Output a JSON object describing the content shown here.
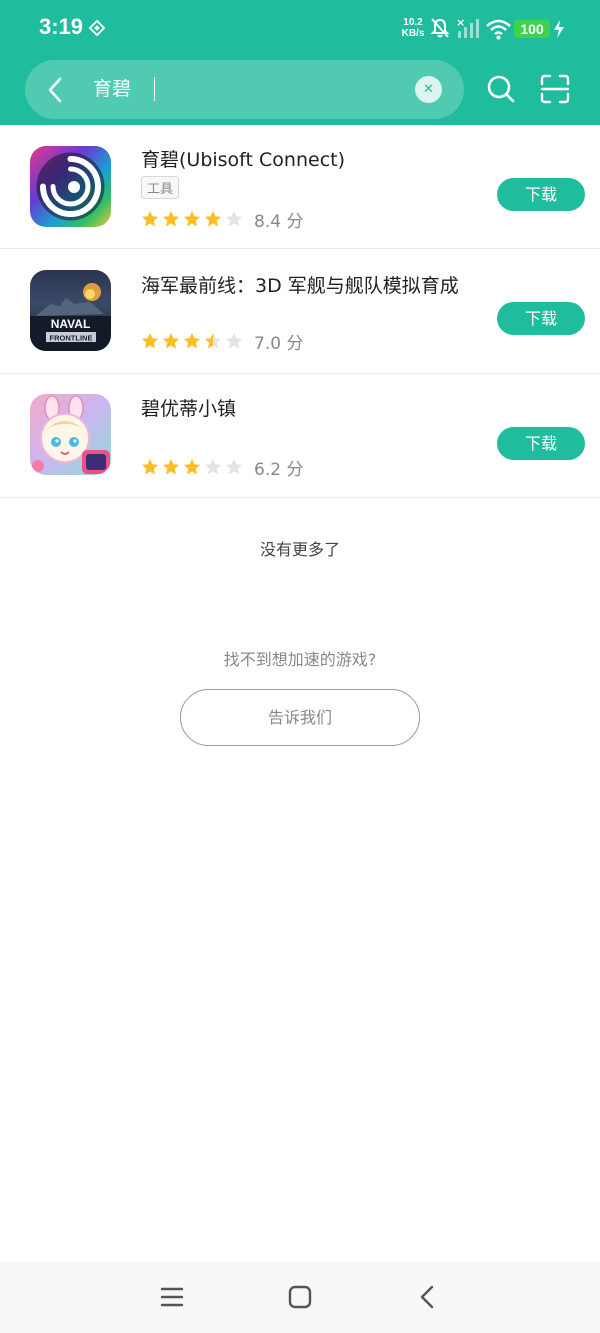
{
  "status_bar": {
    "time": "3:19",
    "net_speed_value": "10.2",
    "net_speed_unit": "KB/s",
    "battery": "100"
  },
  "search": {
    "query": "育碧"
  },
  "results": [
    {
      "name": "育碧(Ubisoft Connect)",
      "tag": "工具",
      "rating_stars": 4,
      "score_text": "8.4 分",
      "button": "下载",
      "icon": "ubisoft-icon"
    },
    {
      "name": "海军最前线：3D 军舰与舰队模拟育成",
      "tag": "",
      "rating_stars": 3.5,
      "score_text": "7.0 分",
      "button": "下载",
      "icon": "naval-frontline-icon",
      "icon_text_1": "NAVAL",
      "icon_text_2": "FRONTLINE"
    },
    {
      "name": "碧优蒂小镇",
      "tag": "",
      "rating_stars": 3,
      "score_text": "6.2 分",
      "button": "下载",
      "icon": "bud-town-icon"
    }
  ],
  "footer": {
    "no_more": "没有更多了",
    "not_found": "找不到想加速的游戏?",
    "tell_us": "告诉我们"
  },
  "colors": {
    "accent": "#1fbd9d",
    "star": "#fbbf24",
    "star_empty": "#e3e3e3"
  }
}
